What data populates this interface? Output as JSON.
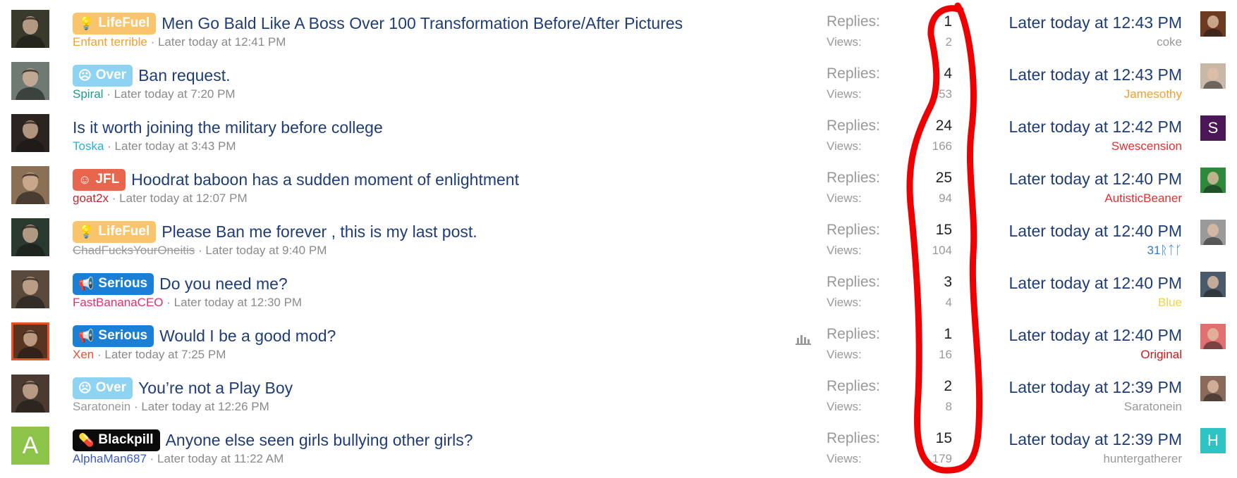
{
  "labels": {
    "replies": "Replies:",
    "views": "Views:"
  },
  "threads": [
    {
      "prefix": {
        "label": "LifeFuel",
        "icon": "lightbulb-icon",
        "glyph": "💡",
        "bg": "#f9c46b"
      },
      "title": "Men Go Bald Like A Boss Over 100 Transformation Before/After Pictures",
      "author": "Enfant terrible",
      "author_color": "#f0a030",
      "author_strike": false,
      "started": "Later today at 12:41 PM",
      "replies": "1",
      "views": "2",
      "last_time": "Later today at 12:43 PM",
      "last_user": "coke",
      "last_user_color": "#999999",
      "avatar_color": "#3a3a2c",
      "avatar_highlight": false,
      "avatar_letter": "",
      "last_avatar_color": "#6b3a20",
      "last_avatar_letter": ""
    },
    {
      "prefix": {
        "label": "Over",
        "icon": "sad-face-icon",
        "glyph": "☹",
        "bg": "#8fd3f2"
      },
      "title": "Ban request.",
      "author": "Spiral",
      "author_color": "#1d9a8a",
      "author_strike": false,
      "started": "Later today at 7:20 PM",
      "replies": "4",
      "views": "53",
      "last_time": "Later today at 12:43 PM",
      "last_user": "Jamesothy",
      "last_user_color": "#f0a030",
      "avatar_color": "#6e7a72",
      "avatar_highlight": false,
      "avatar_letter": "",
      "last_avatar_color": "#c9b7a8",
      "last_avatar_letter": ""
    },
    {
      "prefix": null,
      "title": "Is it worth joining the military before college",
      "author": "Toska",
      "author_color": "#2ab0d8",
      "author_strike": false,
      "started": "Later today at 3:43 PM",
      "replies": "24",
      "views": "166",
      "last_time": "Later today at 12:42 PM",
      "last_user": "Swescension",
      "last_user_color": "#e03030",
      "avatar_color": "#2c2420",
      "avatar_highlight": false,
      "avatar_letter": "",
      "last_avatar_color": "#4a1656",
      "last_avatar_letter": "S"
    },
    {
      "prefix": {
        "label": "JFL",
        "icon": "laugh-icon",
        "glyph": "☺",
        "bg": "#e8664e"
      },
      "title": "Hoodrat baboon has a sudden moment of enlightment",
      "author": "goat2x",
      "author_color": "#c0282e",
      "author_strike": false,
      "started": "Later today at 12:07 PM",
      "replies": "25",
      "views": "94",
      "last_time": "Later today at 12:40 PM",
      "last_user": "AutisticBeaner",
      "last_user_color": "#e03030",
      "avatar_color": "#8a7055",
      "avatar_highlight": false,
      "avatar_letter": "",
      "last_avatar_color": "#2e8a3a",
      "last_avatar_letter": ""
    },
    {
      "prefix": {
        "label": "LifeFuel",
        "icon": "lightbulb-icon",
        "glyph": "💡",
        "bg": "#f9c46b"
      },
      "title": "Please Ban me forever , this is my last post.",
      "author": "ChadFucksYourOneitis",
      "author_color": "#999999",
      "author_strike": true,
      "started": "Later today at 9:40 PM",
      "replies": "15",
      "views": "104",
      "last_time": "Later today at 12:40 PM",
      "last_user": "31ᚱᛏᚴ",
      "last_user_color": "#2a7ad8",
      "avatar_color": "#2a3a2e",
      "avatar_highlight": false,
      "avatar_letter": "",
      "last_avatar_color": "#9a9a9a",
      "last_avatar_letter": ""
    },
    {
      "prefix": {
        "label": "Serious",
        "icon": "megaphone-icon",
        "glyph": "📢",
        "bg": "#1b7fd6"
      },
      "title": "Do you need me?",
      "author": "FastBananaCEO",
      "author_color": "#e0306a",
      "author_strike": false,
      "started": "Later today at 12:30 PM",
      "replies": "3",
      "views": "4",
      "last_time": "Later today at 12:40 PM",
      "last_user": "Blue",
      "last_user_color": "#f2d048",
      "avatar_color": "#5a4a3e",
      "avatar_highlight": false,
      "avatar_letter": "",
      "last_avatar_color": "#4a5a6a",
      "last_avatar_letter": ""
    },
    {
      "prefix": {
        "label": "Serious",
        "icon": "megaphone-icon",
        "glyph": "📢",
        "bg": "#1b7fd6"
      },
      "title": "Would I be a good mod?",
      "author": "Xen",
      "author_color": "#f05030",
      "author_strike": false,
      "started": "Later today at 7:25 PM",
      "replies": "1",
      "views": "16",
      "last_time": "Later today at 12:40 PM",
      "last_user": "Original",
      "last_user_color": "#d01818",
      "avatar_color": "#5a3422",
      "avatar_highlight": true,
      "avatar_letter": "",
      "last_avatar_color": "#e07070",
      "last_avatar_letter": "",
      "has_poll": true
    },
    {
      "prefix": {
        "label": "Over",
        "icon": "sad-face-icon",
        "glyph": "☹",
        "bg": "#8fd3f2"
      },
      "title": "You’re not a Play Boy",
      "author": "Saratonein",
      "author_color": "#999999",
      "author_strike": false,
      "started": "Later today at 12:26 PM",
      "replies": "2",
      "views": "8",
      "last_time": "Later today at 12:39 PM",
      "last_user": "Saratonein",
      "last_user_color": "#999999",
      "avatar_color": "#4a3a30",
      "avatar_highlight": false,
      "avatar_letter": "",
      "last_avatar_color": "#8a6a5a",
      "last_avatar_letter": ""
    },
    {
      "prefix": {
        "label": "Blackpill",
        "icon": "pills-icon",
        "glyph": "💊",
        "bg": "#0a0a0a"
      },
      "title": "Anyone else seen girls bullying other girls?",
      "author": "AlphaMan687",
      "author_color": "#3a5ac8",
      "author_strike": false,
      "started": "Later today at 11:22 AM",
      "replies": "15",
      "views": "179",
      "last_time": "Later today at 12:39 PM",
      "last_user": "huntergatherer",
      "last_user_color": "#999999",
      "avatar_color": "#8cc44a",
      "avatar_highlight": false,
      "avatar_letter": "A",
      "last_avatar_color": "#2ec4c4",
      "last_avatar_letter": "H"
    }
  ]
}
